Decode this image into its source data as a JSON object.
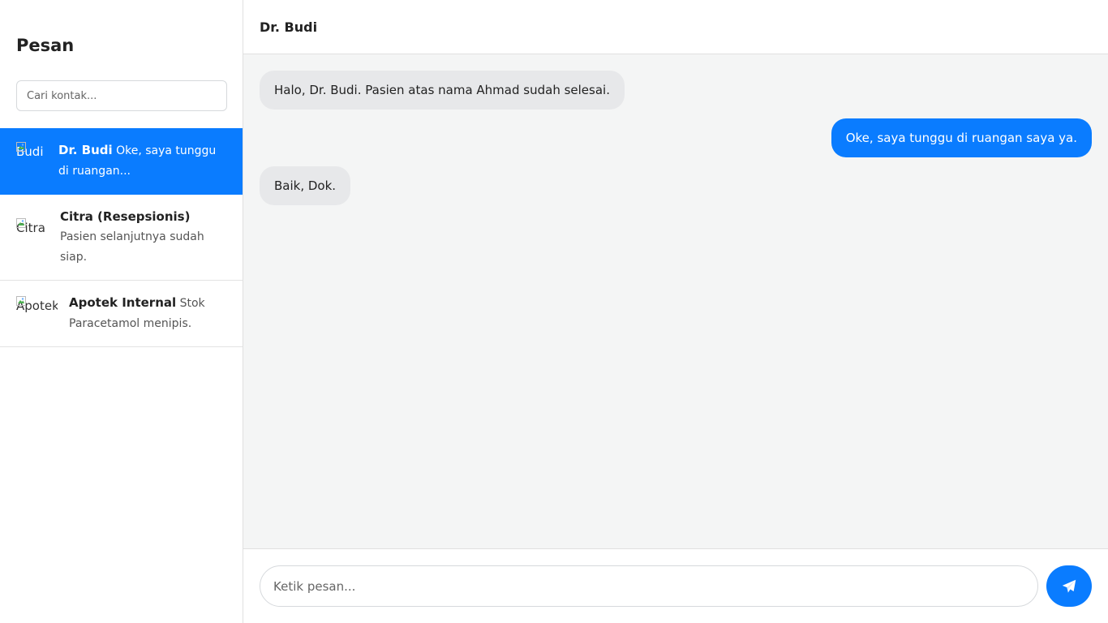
{
  "sidebar": {
    "title": "Pesan",
    "search": {
      "placeholder": "Cari kontak...",
      "value": ""
    },
    "contacts": [
      {
        "avatar_alt": "Budi",
        "name": "Dr. Budi",
        "preview": "Oke, saya tunggu di ruangan...",
        "active": true
      },
      {
        "avatar_alt": "Citra",
        "name": "Citra (Resepsionis)",
        "preview": "Pasien selanjutnya sudah siap.",
        "active": false
      },
      {
        "avatar_alt": "Apotek",
        "name": "Apotek Internal",
        "preview": "Stok Paracetamol menipis.",
        "active": false
      }
    ]
  },
  "chat": {
    "header_name": "Dr. Budi",
    "messages": [
      {
        "direction": "in",
        "text": "Halo, Dr. Budi. Pasien atas nama Ahmad sudah selesai."
      },
      {
        "direction": "out",
        "text": "Oke, saya tunggu di ruangan saya ya."
      },
      {
        "direction": "in",
        "text": "Baik, Dok."
      }
    ],
    "composer": {
      "placeholder": "Ketik pesan...",
      "value": "",
      "send_icon": "paper-plane-icon"
    }
  },
  "colors": {
    "accent": "#0a7cff",
    "incoming_bubble": "#e7e8ea",
    "chat_background": "#f4f5f5"
  }
}
